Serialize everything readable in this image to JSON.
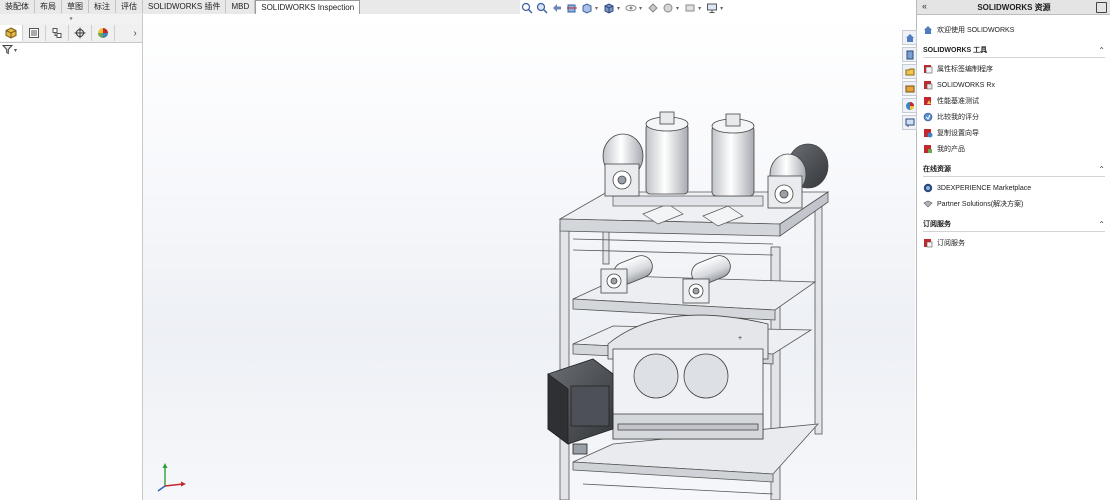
{
  "tabs": [
    "装配体",
    "布局",
    "草图",
    "标注",
    "评估",
    "SOLIDWORKS 插件",
    "MBD",
    "SOLIDWORKS Inspection"
  ],
  "active_tab_index": 7,
  "hud_icons": [
    "zoom-to-fit-icon",
    "zoom-area-icon",
    "previous-view-icon",
    "section-view-icon",
    "view-orientation-icon",
    "display-style-icon",
    "hide-show-icon",
    "edit-appearance-icon",
    "apply-scene-icon",
    "view-settings-icon",
    "monitor-icon"
  ],
  "feature_manager": {
    "tabs": [
      "featuremanager-tree-icon",
      "property-manager-icon",
      "configuration-manager-icon",
      "dimxpert-manager-icon",
      "display-manager-icon"
    ],
    "more_glyph": "›",
    "filter_icon": "filter-icon"
  },
  "task_pane": {
    "title": "SOLIDWORKS 资源",
    "welcome": "欢迎使用 SOLIDWORKS",
    "sections": [
      {
        "title": "SOLIDWORKS 工具",
        "items": [
          "属性标签编制程序",
          "SOLIDWORKS Rx",
          "性能基准测试",
          "比较我的评分",
          "复制设置向导",
          "我的产品"
        ]
      },
      {
        "title": "在线资源",
        "items": [
          "3DEXPERIENCE Marketplace",
          "Partner Solutions(解决方案)"
        ]
      },
      {
        "title": "订阅服务",
        "items": [
          "订阅服务"
        ]
      }
    ],
    "side_tabs": [
      "home-icon",
      "design-library-icon",
      "file-explorer-icon",
      "view-palette-icon",
      "appearances-icon",
      "custom-properties-icon"
    ]
  },
  "colors": {
    "accent_red": "#c4262e",
    "frame_gray": "#c9ccd2",
    "motor_dark": "#4a4d52",
    "background_gradient": "#edf0f5"
  }
}
